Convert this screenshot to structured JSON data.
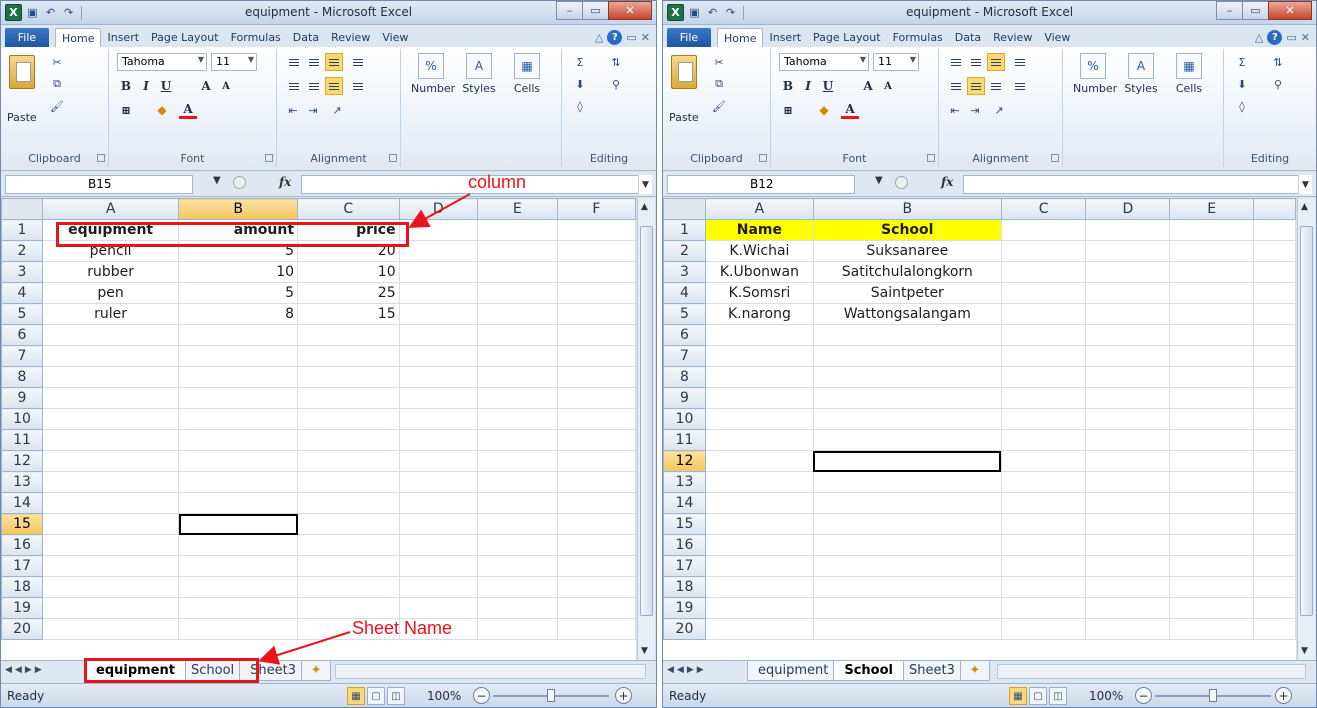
{
  "left": {
    "title": "equipment - Microsoft Excel",
    "name_box": "B15",
    "active_sheet_tab": "equipment",
    "selected_col": "B",
    "selected_row": "15",
    "columns": [
      "A",
      "B",
      "C",
      "D",
      "E",
      "F"
    ],
    "rows": [
      [
        "equipment",
        "amount",
        "price",
        "",
        "",
        ""
      ],
      [
        "pencil",
        "5",
        "20",
        "",
        "",
        ""
      ],
      [
        "rubber",
        "10",
        "10",
        "",
        "",
        ""
      ],
      [
        "pen",
        "5",
        "25",
        "",
        "",
        ""
      ],
      [
        "ruler",
        "8",
        "15",
        "",
        "",
        ""
      ]
    ]
  },
  "right": {
    "title": "equipment - Microsoft Excel",
    "name_box": "B12",
    "active_sheet_tab": "School",
    "selected_col": "",
    "selected_row": "12",
    "columns": [
      "A",
      "B",
      "C",
      "D",
      "E"
    ],
    "rows": [
      [
        "Name",
        "School",
        "",
        "",
        ""
      ],
      [
        "K.Wichai",
        "Suksanaree",
        "",
        "",
        ""
      ],
      [
        "K.Ubonwan",
        "Satitchulalongkorn",
        "",
        "",
        ""
      ],
      [
        "K.Somsri",
        "Saintpeter",
        "",
        "",
        ""
      ],
      [
        "K.narong",
        "Wattongsalangam",
        "",
        "",
        ""
      ]
    ]
  },
  "ribbon": {
    "file": "File",
    "tabs": [
      "Home",
      "Insert",
      "Page Layout",
      "Formulas",
      "Data",
      "Review",
      "View"
    ],
    "font_name": "Tahoma",
    "font_size": "11",
    "paste": "Paste",
    "groups": {
      "clipboard": "Clipboard",
      "font": "Font",
      "alignment": "Alignment",
      "editing": "Editing"
    },
    "number": "Number",
    "styles": "Styles",
    "cells": "Cells",
    "fx": "fx"
  },
  "row_numbers": [
    "1",
    "2",
    "3",
    "4",
    "5",
    "6",
    "7",
    "8",
    "9",
    "10",
    "11",
    "12",
    "13",
    "14",
    "15",
    "16",
    "17",
    "18",
    "19",
    "20"
  ],
  "sheet_tabs": [
    "equipment",
    "School",
    "Sheet3"
  ],
  "status": {
    "ready": "Ready",
    "zoom": "100%"
  },
  "annotations": {
    "column": "column",
    "sheet_name": "Sheet Name",
    "color": "#e8141b"
  },
  "icons": [
    "excel-logo-icon",
    "save-icon",
    "undo-icon",
    "redo-icon",
    "help-icon",
    "minimize-icon",
    "maximize-icon",
    "close-icon",
    "paste-icon",
    "cut-icon",
    "copy-icon",
    "format-painter-icon",
    "autosum-icon",
    "sort-filter-icon",
    "find-icon",
    "fill-icon",
    "clear-icon",
    "fx-icon",
    "normal-view-icon",
    "page-layout-view-icon",
    "page-break-view-icon"
  ]
}
